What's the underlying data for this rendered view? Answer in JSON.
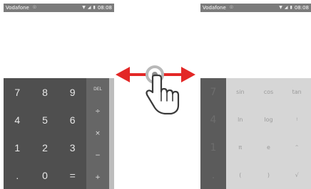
{
  "left_phone": {
    "status": {
      "carrier": "Vodafone",
      "time": "08:08"
    },
    "numpad": [
      "7",
      "8",
      "9",
      "4",
      "5",
      "6",
      "1",
      "2",
      "3",
      ".",
      "0",
      "="
    ],
    "ops": [
      "DEL",
      "÷",
      "×",
      "−",
      "+"
    ]
  },
  "right_phone": {
    "status": {
      "carrier": "Vodafone",
      "time": "08:08"
    },
    "numpad_dim": [
      "7",
      "4",
      "1",
      "."
    ],
    "advanced": [
      "sin",
      "cos",
      "tan",
      "ln",
      "log",
      "!",
      "π",
      "e",
      "^",
      "(",
      ")",
      "√"
    ]
  },
  "icons": {
    "gesture": "swipe-hand-icon",
    "arrow_left": "arrow-left-icon",
    "arrow_right": "arrow-right-icon"
  },
  "colors": {
    "arrow": "#e32726",
    "statusbar": "#7b7b7b",
    "keypad_dark": "#4f4f4f",
    "keypad_ops": "#666666",
    "advanced_panel": "#d6d6d6"
  }
}
